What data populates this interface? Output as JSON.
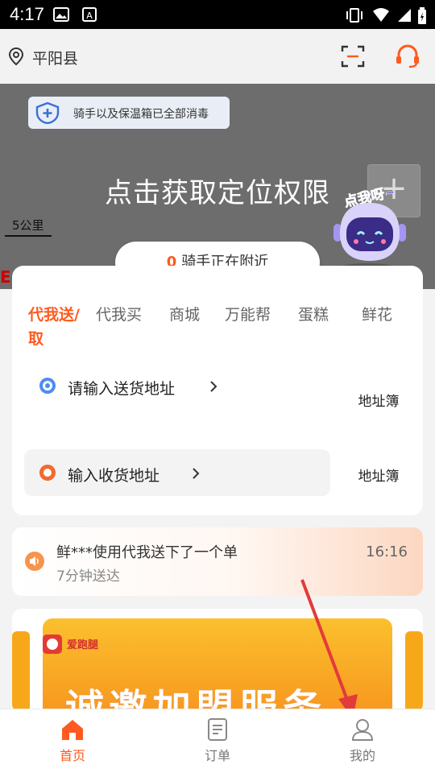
{
  "status_bar": {
    "time": "4:17"
  },
  "header": {
    "city": "平阳县"
  },
  "map": {
    "disinfect_notice": "骑手以及保温箱已全部消毒",
    "location_permission": "点击获取定位权限",
    "scale_label": "5公里",
    "robot_bubble": "点我呀~"
  },
  "riders": {
    "count": "0",
    "text": "骑手正在附近"
  },
  "tabs": [
    "代我送/取",
    "代我买",
    "商城",
    "万能帮",
    "蛋糕",
    "鲜花"
  ],
  "address": {
    "send_label": "请输入送货地址",
    "receive_label": "输入收货地址",
    "book_label": "地址簿"
  },
  "notice": {
    "message": "鲜***使用代我送下了一个单",
    "sub": "7分钟送达",
    "time": "16:16"
  },
  "banner": {
    "logo_text": "爱跑腿",
    "title": "诚邀加盟服务"
  },
  "bottom_nav": [
    {
      "label": "首页",
      "icon": "home-icon"
    },
    {
      "label": "订单",
      "icon": "orders-icon"
    },
    {
      "label": "我的",
      "icon": "profile-icon"
    }
  ],
  "colors": {
    "accent": "#ff5a1f",
    "arrow": "#e23b3b"
  }
}
